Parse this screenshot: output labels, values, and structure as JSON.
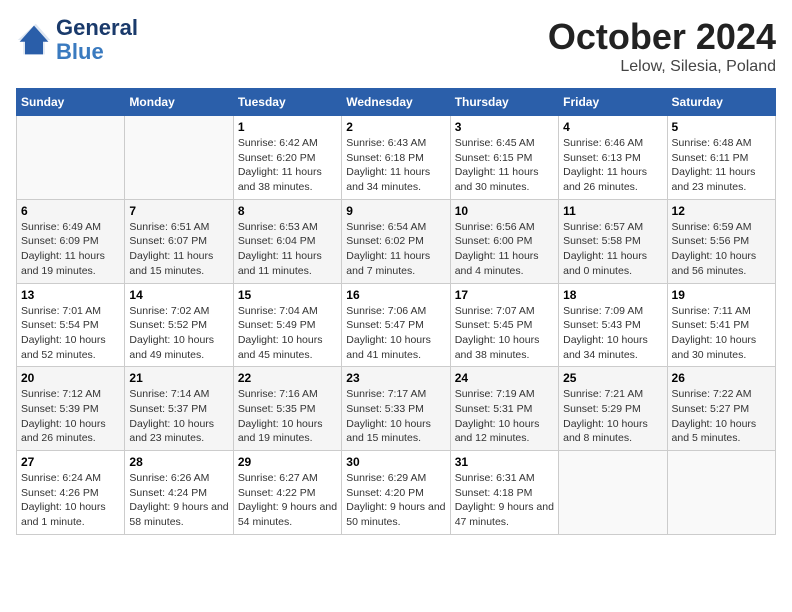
{
  "header": {
    "logo_general": "General",
    "logo_blue": "Blue",
    "title": "October 2024",
    "subtitle": "Lelow, Silesia, Poland"
  },
  "weekdays": [
    "Sunday",
    "Monday",
    "Tuesday",
    "Wednesday",
    "Thursday",
    "Friday",
    "Saturday"
  ],
  "weeks": [
    [
      {
        "day": "",
        "info": ""
      },
      {
        "day": "",
        "info": ""
      },
      {
        "day": "1",
        "info": "Sunrise: 6:42 AM\nSunset: 6:20 PM\nDaylight: 11 hours and 38 minutes."
      },
      {
        "day": "2",
        "info": "Sunrise: 6:43 AM\nSunset: 6:18 PM\nDaylight: 11 hours and 34 minutes."
      },
      {
        "day": "3",
        "info": "Sunrise: 6:45 AM\nSunset: 6:15 PM\nDaylight: 11 hours and 30 minutes."
      },
      {
        "day": "4",
        "info": "Sunrise: 6:46 AM\nSunset: 6:13 PM\nDaylight: 11 hours and 26 minutes."
      },
      {
        "day": "5",
        "info": "Sunrise: 6:48 AM\nSunset: 6:11 PM\nDaylight: 11 hours and 23 minutes."
      }
    ],
    [
      {
        "day": "6",
        "info": "Sunrise: 6:49 AM\nSunset: 6:09 PM\nDaylight: 11 hours and 19 minutes."
      },
      {
        "day": "7",
        "info": "Sunrise: 6:51 AM\nSunset: 6:07 PM\nDaylight: 11 hours and 15 minutes."
      },
      {
        "day": "8",
        "info": "Sunrise: 6:53 AM\nSunset: 6:04 PM\nDaylight: 11 hours and 11 minutes."
      },
      {
        "day": "9",
        "info": "Sunrise: 6:54 AM\nSunset: 6:02 PM\nDaylight: 11 hours and 7 minutes."
      },
      {
        "day": "10",
        "info": "Sunrise: 6:56 AM\nSunset: 6:00 PM\nDaylight: 11 hours and 4 minutes."
      },
      {
        "day": "11",
        "info": "Sunrise: 6:57 AM\nSunset: 5:58 PM\nDaylight: 11 hours and 0 minutes."
      },
      {
        "day": "12",
        "info": "Sunrise: 6:59 AM\nSunset: 5:56 PM\nDaylight: 10 hours and 56 minutes."
      }
    ],
    [
      {
        "day": "13",
        "info": "Sunrise: 7:01 AM\nSunset: 5:54 PM\nDaylight: 10 hours and 52 minutes."
      },
      {
        "day": "14",
        "info": "Sunrise: 7:02 AM\nSunset: 5:52 PM\nDaylight: 10 hours and 49 minutes."
      },
      {
        "day": "15",
        "info": "Sunrise: 7:04 AM\nSunset: 5:49 PM\nDaylight: 10 hours and 45 minutes."
      },
      {
        "day": "16",
        "info": "Sunrise: 7:06 AM\nSunset: 5:47 PM\nDaylight: 10 hours and 41 minutes."
      },
      {
        "day": "17",
        "info": "Sunrise: 7:07 AM\nSunset: 5:45 PM\nDaylight: 10 hours and 38 minutes."
      },
      {
        "day": "18",
        "info": "Sunrise: 7:09 AM\nSunset: 5:43 PM\nDaylight: 10 hours and 34 minutes."
      },
      {
        "day": "19",
        "info": "Sunrise: 7:11 AM\nSunset: 5:41 PM\nDaylight: 10 hours and 30 minutes."
      }
    ],
    [
      {
        "day": "20",
        "info": "Sunrise: 7:12 AM\nSunset: 5:39 PM\nDaylight: 10 hours and 26 minutes."
      },
      {
        "day": "21",
        "info": "Sunrise: 7:14 AM\nSunset: 5:37 PM\nDaylight: 10 hours and 23 minutes."
      },
      {
        "day": "22",
        "info": "Sunrise: 7:16 AM\nSunset: 5:35 PM\nDaylight: 10 hours and 19 minutes."
      },
      {
        "day": "23",
        "info": "Sunrise: 7:17 AM\nSunset: 5:33 PM\nDaylight: 10 hours and 15 minutes."
      },
      {
        "day": "24",
        "info": "Sunrise: 7:19 AM\nSunset: 5:31 PM\nDaylight: 10 hours and 12 minutes."
      },
      {
        "day": "25",
        "info": "Sunrise: 7:21 AM\nSunset: 5:29 PM\nDaylight: 10 hours and 8 minutes."
      },
      {
        "day": "26",
        "info": "Sunrise: 7:22 AM\nSunset: 5:27 PM\nDaylight: 10 hours and 5 minutes."
      }
    ],
    [
      {
        "day": "27",
        "info": "Sunrise: 6:24 AM\nSunset: 4:26 PM\nDaylight: 10 hours and 1 minute."
      },
      {
        "day": "28",
        "info": "Sunrise: 6:26 AM\nSunset: 4:24 PM\nDaylight: 9 hours and 58 minutes."
      },
      {
        "day": "29",
        "info": "Sunrise: 6:27 AM\nSunset: 4:22 PM\nDaylight: 9 hours and 54 minutes."
      },
      {
        "day": "30",
        "info": "Sunrise: 6:29 AM\nSunset: 4:20 PM\nDaylight: 9 hours and 50 minutes."
      },
      {
        "day": "31",
        "info": "Sunrise: 6:31 AM\nSunset: 4:18 PM\nDaylight: 9 hours and 47 minutes."
      },
      {
        "day": "",
        "info": ""
      },
      {
        "day": "",
        "info": ""
      }
    ]
  ]
}
